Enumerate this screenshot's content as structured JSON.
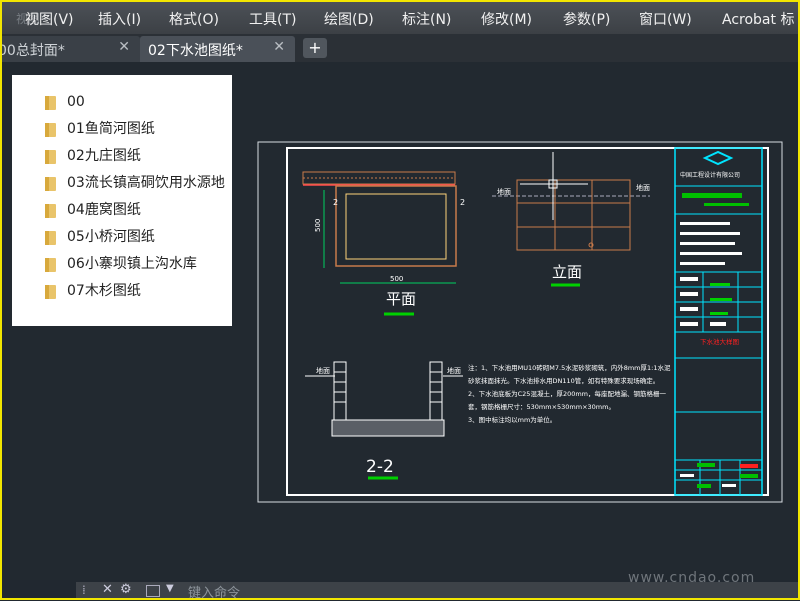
{
  "menu": {
    "ghost": "视图",
    "items": [
      "视图(V)",
      "插入(I)",
      "格式(O)",
      "工具(T)",
      "绘图(D)",
      "标注(N)",
      "修改(M)",
      "参数(P)",
      "窗口(W)",
      "Acrobat 标"
    ]
  },
  "tabs": [
    {
      "label": "00总封面*",
      "active": false
    },
    {
      "label": "02下水池图纸*",
      "active": true
    }
  ],
  "new_tab_label": "+",
  "close_glyph": "✕",
  "folders": [
    "00",
    "01鱼简河图纸",
    "02九庄图纸",
    "03流长镇高硐饮用水源地",
    "04鹿窝图纸",
    "05小桥河图纸",
    "06小寨坝镇上沟水库",
    "07木杉图纸"
  ],
  "drawing": {
    "plan_title": "平面",
    "elevation_title": "立面",
    "section_title": "2-2",
    "dim_500_h": "500",
    "dim_500_v": "500",
    "section_marker": "2",
    "ground_label": "地面",
    "notes": [
      "注：1、下水池用MU10砖砌M7.5水泥砂浆砌筑，内外8mm厚1:1水泥",
      "砂浆抹面抹光。下水池排水用DN110管，如有特殊要求现场确定。",
      "2、下水池底板为C25混凝土，厚200mm，每座配地漏、钢筋格栅一",
      "套，钢筋格栅尺寸：530mm×530mm×30mm。",
      "3、图中标注均以mm为单位。"
    ],
    "title_block_company": "中国工程设计有限公司",
    "title_block_sheet": "下水池大样图"
  },
  "command": {
    "placeholder": "键入命令"
  },
  "watermark": "www.cndao.com",
  "colors": {
    "cad_bg": "#222930",
    "frame": "#f2e600",
    "cyan": "#00e5ff",
    "green": "#00c000",
    "red": "#ff2020",
    "orange": "#c87a4a"
  }
}
